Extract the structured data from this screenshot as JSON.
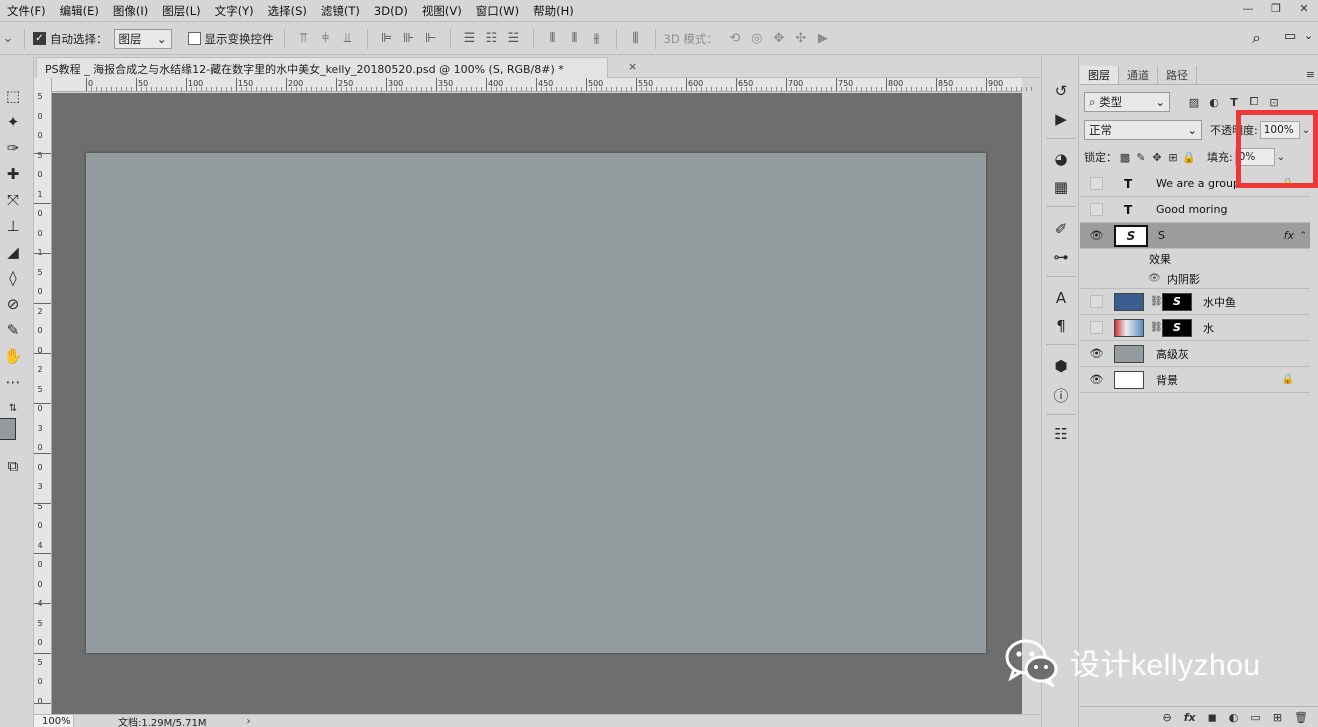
{
  "menubar": {
    "items": [
      "文件(F)",
      "编辑(E)",
      "图像(I)",
      "图层(L)",
      "文字(Y)",
      "选择(S)",
      "滤镜(T)",
      "3D(D)",
      "视图(V)",
      "窗口(W)",
      "帮助(H)"
    ]
  },
  "window_controls": {
    "minimize": "—",
    "restore": "❐",
    "close": "✕"
  },
  "options": {
    "auto_select_checked": true,
    "auto_select_label": "自动选择：",
    "auto_select_value": "图层",
    "transform_checked": false,
    "transform_label": "显示变换控件",
    "mode_label": "3D 模式：",
    "search_icon": "⌕",
    "workspace_icon": "▭"
  },
  "document": {
    "tab_title": "PS教程 _ 海报合成之与水结缘12-藏在数字里的水中美女_kelly_20180520.psd @ 100% (S, RGB/8#) *",
    "close": "×",
    "zoom": "100%",
    "info": "文档:1.29M/5.71M",
    "arrow": "›"
  },
  "ruler": {
    "top_labels": [
      "0",
      "50",
      "100",
      "150",
      "200",
      "250",
      "300",
      "350",
      "400",
      "450",
      "500",
      "550",
      "600",
      "650",
      "700",
      "750",
      "800",
      "850",
      "900"
    ],
    "left_labels": [
      "5",
      "0",
      "0",
      "5",
      "0",
      "1",
      "0",
      "0",
      "1",
      "5",
      "0",
      "2",
      "0",
      "0",
      "2",
      "5",
      "0",
      "3",
      "0",
      "0",
      "3",
      "5",
      "0",
      "4",
      "0",
      "0",
      "4",
      "5",
      "0",
      "5",
      "0",
      "0"
    ]
  },
  "layers_panel": {
    "tabs": [
      "图层",
      "通道",
      "路径"
    ],
    "menu_icon": "≡",
    "filter_label": "⌕ 类型",
    "blend_mode": "正常",
    "opacity_label": "不透明度:",
    "opacity_value": "100%",
    "lock_label": "锁定：",
    "fill_label": "填充:",
    "fill_value": "0%",
    "layers": [
      {
        "name": "We are a group",
        "visible": false,
        "kind": "text"
      },
      {
        "name": "Good moring",
        "visible": false,
        "kind": "text"
      },
      {
        "name": "S",
        "visible": true,
        "kind": "smart",
        "selected": true,
        "fx": "fx"
      },
      {
        "name": "水中鱼",
        "visible": false,
        "kind": "masked"
      },
      {
        "name": "水",
        "visible": false,
        "kind": "masked"
      },
      {
        "name": "高级灰",
        "visible": true,
        "kind": "fill"
      },
      {
        "name": "背景",
        "visible": true,
        "kind": "background",
        "locked": true
      }
    ],
    "effects_label": "效果",
    "effect_name": "内阴影",
    "footer_icons": [
      "⊖",
      "fx",
      "◼",
      "◐",
      "▭",
      "⊞",
      "🗑"
    ]
  },
  "watermark": {
    "text": "设计kellyzhou"
  }
}
